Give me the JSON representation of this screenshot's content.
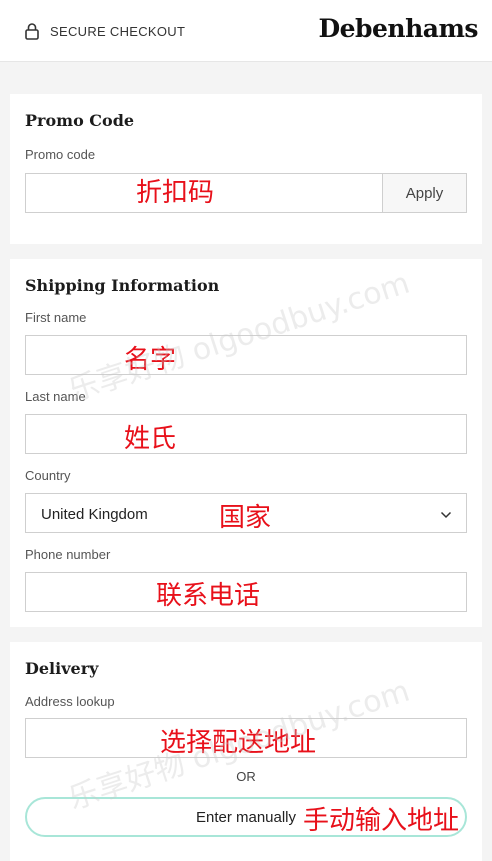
{
  "header": {
    "secure_label": "SECURE CHECKOUT",
    "brand": "Debenhams"
  },
  "promo": {
    "title": "Promo Code",
    "label": "Promo code",
    "overlay": "折扣码",
    "apply_label": "Apply"
  },
  "shipping": {
    "title": "Shipping Information",
    "first_name_label": "First name",
    "first_name_overlay": "名字",
    "last_name_label": "Last name",
    "last_name_overlay": "姓氏",
    "country_label": "Country",
    "country_value": "United Kingdom",
    "country_overlay": "国家",
    "phone_label": "Phone number",
    "phone_overlay": "联系电话"
  },
  "delivery": {
    "title": "Delivery",
    "address_label": "Address lookup",
    "address_overlay": "选择配送地址",
    "or_label": "OR",
    "manual_label": "Enter manually",
    "manual_overlay": "手动输入地址"
  },
  "watermarks": {
    "top": "乐享好物 olgoodbuy.com",
    "bottom": "乐享好物 olgoodbuy.com"
  },
  "colors": {
    "overlay_red": "#e8101a",
    "manual_border": "#a8e6d8"
  }
}
